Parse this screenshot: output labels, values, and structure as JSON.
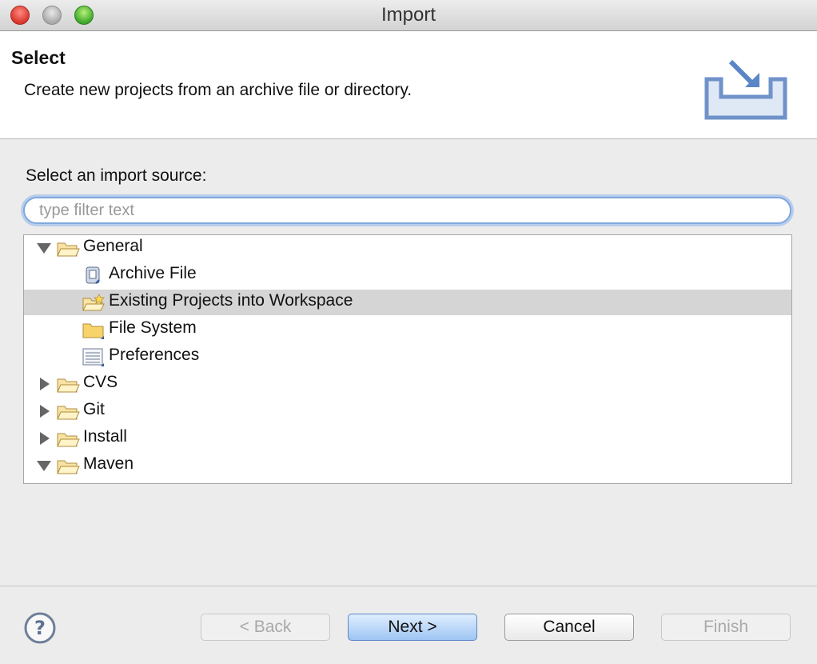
{
  "window": {
    "title": "Import"
  },
  "header": {
    "title": "Select",
    "description": "Create new projects from an archive file or directory."
  },
  "body": {
    "source_label": "Select an import source:",
    "filter": {
      "placeholder": "type filter text",
      "value": ""
    },
    "tree": [
      {
        "label": "General",
        "type": "folder",
        "expanded": true,
        "icon": "folder-open-icon"
      },
      {
        "label": "Archive File",
        "type": "item",
        "icon": "archive-icon"
      },
      {
        "label": "Existing Projects into Workspace",
        "type": "item",
        "icon": "project-folder-icon",
        "selected": true
      },
      {
        "label": "File System",
        "type": "item",
        "icon": "folder-icon"
      },
      {
        "label": "Preferences",
        "type": "item",
        "icon": "preferences-icon"
      },
      {
        "label": "CVS",
        "type": "folder",
        "expanded": false,
        "icon": "folder-open-icon"
      },
      {
        "label": "Git",
        "type": "folder",
        "expanded": false,
        "icon": "folder-open-icon"
      },
      {
        "label": "Install",
        "type": "folder",
        "expanded": false,
        "icon": "folder-open-icon"
      },
      {
        "label": "Maven",
        "type": "folder",
        "expanded": true,
        "icon": "folder-open-icon"
      }
    ]
  },
  "footer": {
    "back_label": "< Back",
    "next_label": "Next >",
    "cancel_label": "Cancel",
    "finish_label": "Finish"
  },
  "colors": {
    "selection": "#d5d5d5",
    "focus_ring": "#7fa8df",
    "primary_button": "#9ec5f3"
  }
}
